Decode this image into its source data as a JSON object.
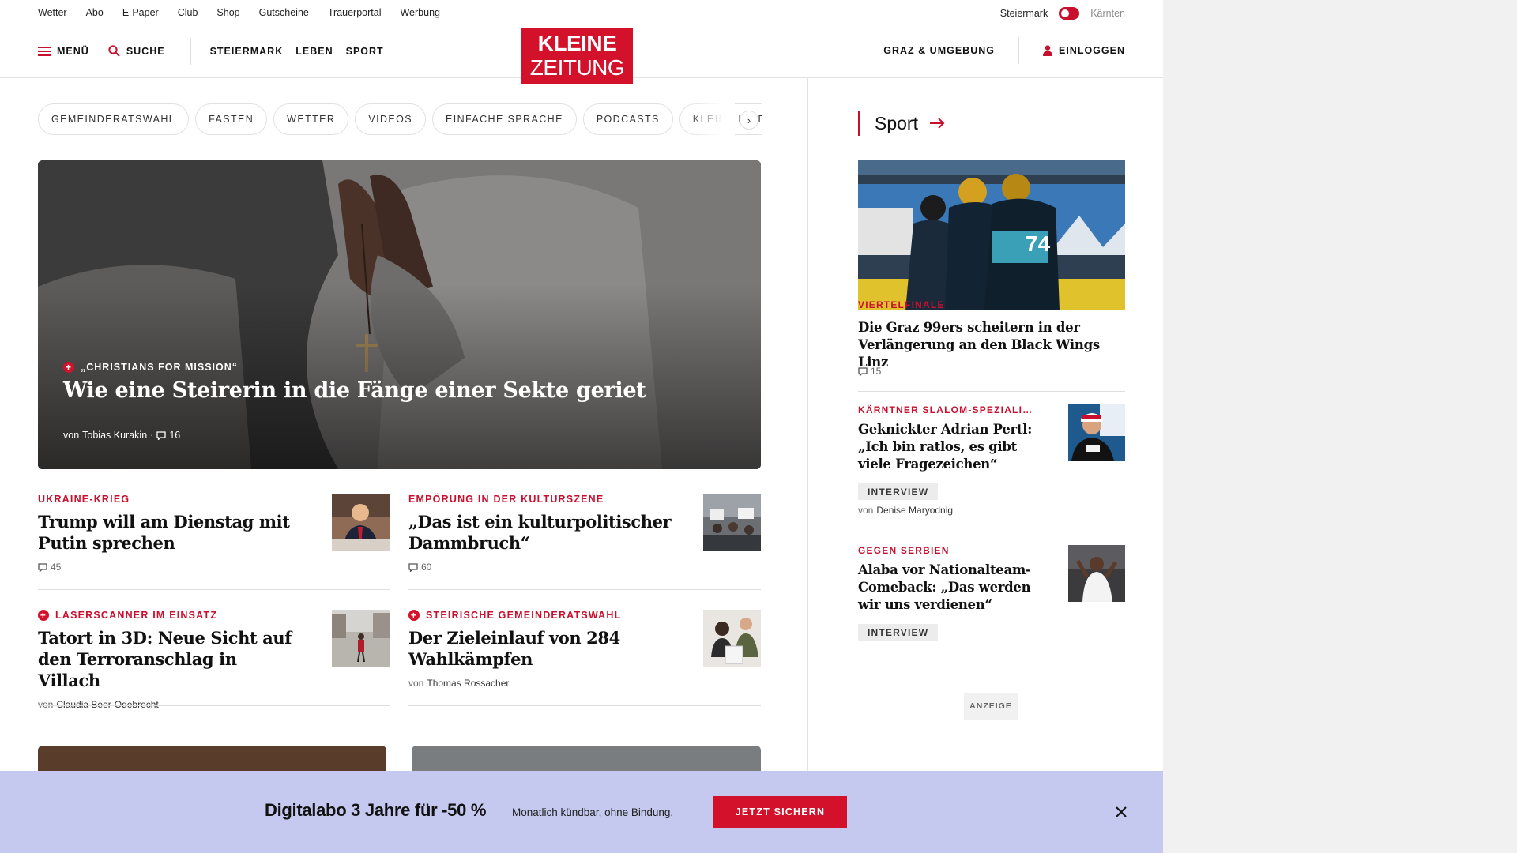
{
  "utility": {
    "links": [
      "Wetter",
      "Abo",
      "E-Paper",
      "Club",
      "Shop",
      "Gutscheine",
      "Trauerportal",
      "Werbung"
    ],
    "region_active": "Steiermark",
    "region_inactive": "Kärnten"
  },
  "header": {
    "menu": "MENÜ",
    "search": "SUCHE",
    "categories": [
      "STEIERMARK",
      "LEBEN",
      "SPORT"
    ],
    "logo_line1": "KLEINE",
    "logo_line2": "ZEITUNG",
    "local": "GRAZ & UMGEBUNG",
    "login": "EINLOGGEN"
  },
  "chips": [
    "GEMEINDERATSWAHL",
    "FASTEN",
    "WETTER",
    "VIDEOS",
    "EINFACHE SPRACHE",
    "PODCASTS",
    "KLEINE KINDER"
  ],
  "hero": {
    "kicker": "„CHRISTIANS FOR MISSION“",
    "title": "Wie eine Steirerin in die Fänge einer Sekte geriet",
    "author_prefix": "von",
    "author": "Tobias Kurakin",
    "comments": "16"
  },
  "articles": [
    {
      "kicker": "UKRAINE-KRIEG",
      "headline": "Trump will am Dienstag mit Putin sprechen",
      "comments": "45"
    },
    {
      "kicker": "EMPÖRUNG IN DER KULTURSZENE",
      "headline": "„Das ist ein kulturpolitischer Dammbruch“",
      "comments": "60"
    },
    {
      "kicker": "LASERSCANNER IM EINSATZ",
      "headline": "Tatort in 3D: Neue Sicht auf den Terroranschlag in Villach",
      "author_prefix": "von",
      "author": "Claudia Beer-Odebrecht"
    },
    {
      "kicker": "STEIRISCHE GEMEINDERATSWAHL",
      "headline": "Der Zieleinlauf von 284 Wahlkämpfen",
      "author_prefix": "von",
      "author": "Thomas Rossacher"
    }
  ],
  "sidebar": {
    "section": "Sport",
    "lead": {
      "kicker": "VIERTELFINALE",
      "headline": "Die Graz 99ers scheitern in der Verlängerung an den Black Wings Linz",
      "comments": "15"
    },
    "items": [
      {
        "kicker": "KÄRNTNER SLALOM-SPEZIALI…",
        "headline": "Geknickter Adrian Pertl: „Ich bin ratlos, es gibt viele Fragezeichen“",
        "badge": "INTERVIEW",
        "author_prefix": "von",
        "author": "Denise Maryodnig"
      },
      {
        "kicker": "GEGEN SERBIEN",
        "headline": "Alaba vor Nationalteam-Comeback: „Das werden wir uns verdienen“",
        "badge": "INTERVIEW"
      }
    ],
    "ad_label": "ANZEIGE"
  },
  "promo": {
    "title": "Digitalabo 3 Jahre für -50 %",
    "subtitle": "Monatlich kündbar, ohne Bindung.",
    "button": "JETZT SICHERN"
  },
  "colors": {
    "brand_red": "#d3112a",
    "promo_bg": "#c5c9ef"
  }
}
